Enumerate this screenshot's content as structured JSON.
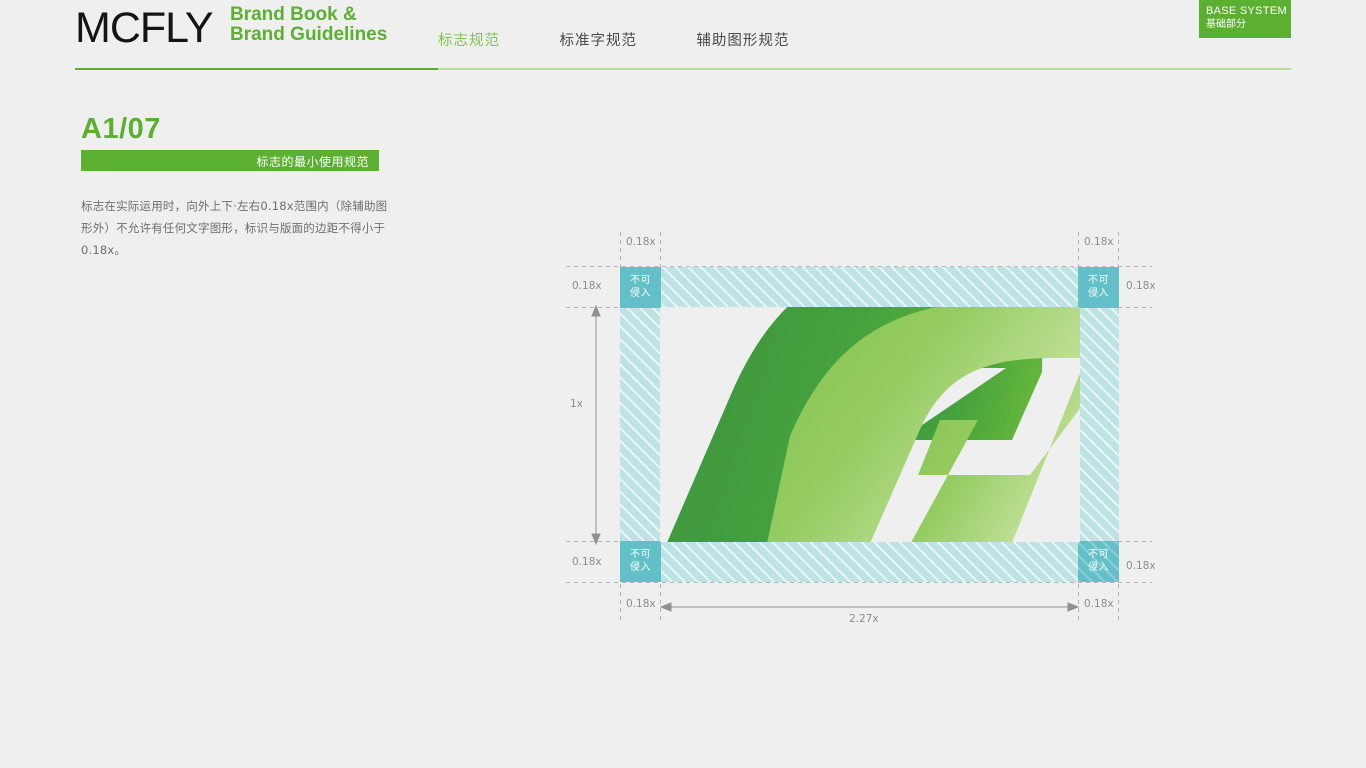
{
  "header": {
    "wordmark": "MCFLY",
    "brand_line1": "Brand Book &",
    "brand_line2": "Brand Guidelines",
    "tabs": [
      {
        "label": "标志规范",
        "active": true
      },
      {
        "label": "标准字规范",
        "active": false
      },
      {
        "label": "辅助图形规范",
        "active": false
      }
    ],
    "badge_en": "BASE SYSTEM",
    "badge_cn": "基础部分"
  },
  "section": {
    "code": "A1/07",
    "bar_title": "标志的最小使用规范",
    "body": "标志在实际运用时，向外上下·左右0.18x范围内（除辅助图形外）不允许有任何文字图形，标识与版面的边距不得小于0.18x。"
  },
  "diagram": {
    "zone_text_line1": "不可",
    "zone_text_line2": "侵入",
    "margin_label": "0.18x",
    "height_label": "1x",
    "width_label": "2.27x",
    "labels": {
      "top_left_col": "0.18x",
      "top_right_col": "0.18x",
      "left_row_top": "0.18x",
      "right_row_top": "0.18x",
      "left_row_bottom": "0.18x",
      "right_row_bottom": "0.18x",
      "bottom_left_col": "0.18x",
      "bottom_right_col": "0.18x"
    }
  },
  "colors": {
    "brand_green": "#5cb031",
    "accent_light_green": "#84c44c",
    "logo_dark_green": "#429a3c",
    "logo_light_green": "#8cc64f",
    "zone_solid": "#63c0c8",
    "zone_hatch": "#bde3e5",
    "page_bg": "#efefef",
    "guide_line": "#b0b0b0"
  }
}
